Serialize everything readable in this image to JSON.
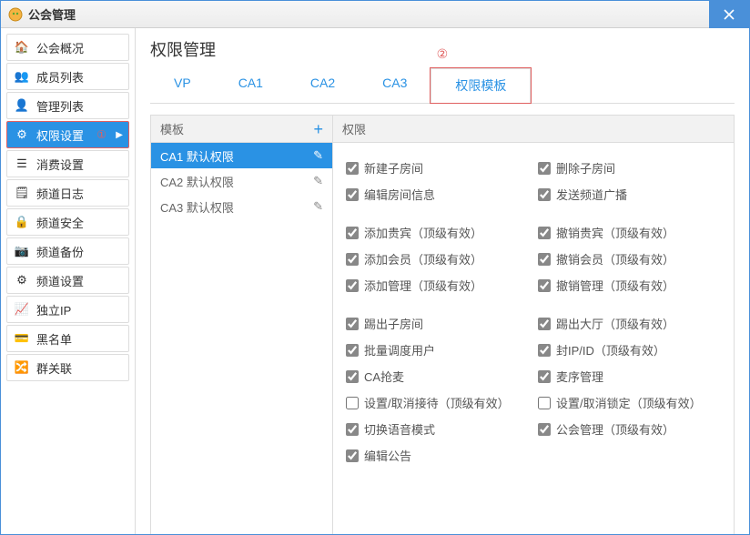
{
  "window": {
    "title": "公会管理"
  },
  "sidebar": {
    "items": [
      {
        "icon": "🏠",
        "label": "公会概况"
      },
      {
        "icon": "👥",
        "label": "成员列表"
      },
      {
        "icon": "👤",
        "label": "管理列表"
      },
      {
        "icon": "⚙",
        "label": "权限设置"
      },
      {
        "icon": "☰",
        "label": "消费设置"
      },
      {
        "icon": "🗒",
        "label": "频道日志"
      },
      {
        "icon": "🔒",
        "label": "频道安全"
      },
      {
        "icon": "📷",
        "label": "频道备份"
      },
      {
        "icon": "⚙",
        "label": "频道设置"
      },
      {
        "icon": "📈",
        "label": "独立IP"
      },
      {
        "icon": "💳",
        "label": "黑名单"
      },
      {
        "icon": "🔀",
        "label": "群关联"
      }
    ],
    "active_index": 3
  },
  "annotations": {
    "one": "①",
    "two": "②"
  },
  "page": {
    "title": "权限管理"
  },
  "tabs": {
    "items": [
      "VP",
      "CA1",
      "CA2",
      "CA3",
      "权限模板"
    ],
    "active_index": 4
  },
  "templates": {
    "header": "模板",
    "add_icon": "+",
    "items": [
      {
        "label": "CA1 默认权限",
        "active": true
      },
      {
        "label": "CA2 默认权限",
        "active": false
      },
      {
        "label": "CA3 默认权限",
        "active": false
      }
    ],
    "edit_icon": "✎"
  },
  "permissions": {
    "header": "权限",
    "groups": [
      [
        {
          "label": "新建子房间",
          "checked": true
        },
        {
          "label": "删除子房间",
          "checked": true
        },
        {
          "label": "编辑房间信息",
          "checked": true
        },
        {
          "label": "发送频道广播",
          "checked": true
        }
      ],
      [
        {
          "label": "添加贵宾（顶级有效）",
          "checked": true
        },
        {
          "label": "撤销贵宾（顶级有效）",
          "checked": true
        },
        {
          "label": "添加会员（顶级有效）",
          "checked": true
        },
        {
          "label": "撤销会员（顶级有效）",
          "checked": true
        },
        {
          "label": "添加管理（顶级有效）",
          "checked": true
        },
        {
          "label": "撤销管理（顶级有效）",
          "checked": true
        }
      ],
      [
        {
          "label": "踢出子房间",
          "checked": true
        },
        {
          "label": "踢出大厅（顶级有效）",
          "checked": true
        },
        {
          "label": "批量调度用户",
          "checked": true
        },
        {
          "label": "封IP/ID（顶级有效）",
          "checked": true
        },
        {
          "label": "CA抢麦",
          "checked": true
        },
        {
          "label": "麦序管理",
          "checked": true
        },
        {
          "label": "设置/取消接待（顶级有效）",
          "checked": false
        },
        {
          "label": "设置/取消锁定（顶级有效）",
          "checked": false
        },
        {
          "label": "切换语音模式",
          "checked": true
        },
        {
          "label": "公会管理（顶级有效）",
          "checked": true
        },
        {
          "label": "编辑公告",
          "checked": true
        }
      ]
    ]
  }
}
